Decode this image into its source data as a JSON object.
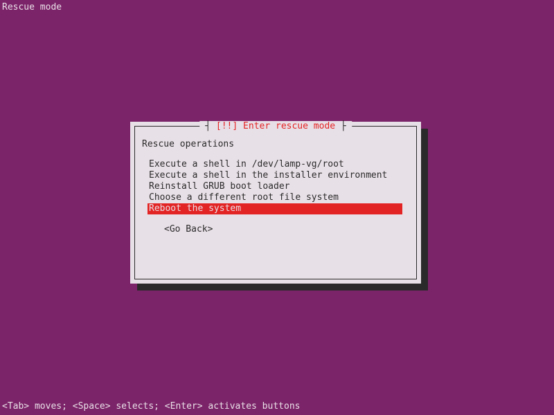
{
  "header": {
    "title": "Rescue mode"
  },
  "dialog": {
    "title_deco_left": "┤ ",
    "title_marker": "[!!]",
    "title_text": " Enter rescue mode",
    "title_deco_right": " ├",
    "section_label": "Rescue operations",
    "menu_items": [
      {
        "label": "Execute a shell in /dev/lamp-vg/root",
        "selected": false
      },
      {
        "label": "Execute a shell in the installer environment",
        "selected": false
      },
      {
        "label": "Reinstall GRUB boot loader",
        "selected": false
      },
      {
        "label": "Choose a different root file system",
        "selected": false
      },
      {
        "label": "Reboot the system",
        "selected": true
      }
    ],
    "go_back_label": "<Go Back>"
  },
  "footer": {
    "hint": "<Tab> moves; <Space> selects; <Enter> activates buttons"
  }
}
